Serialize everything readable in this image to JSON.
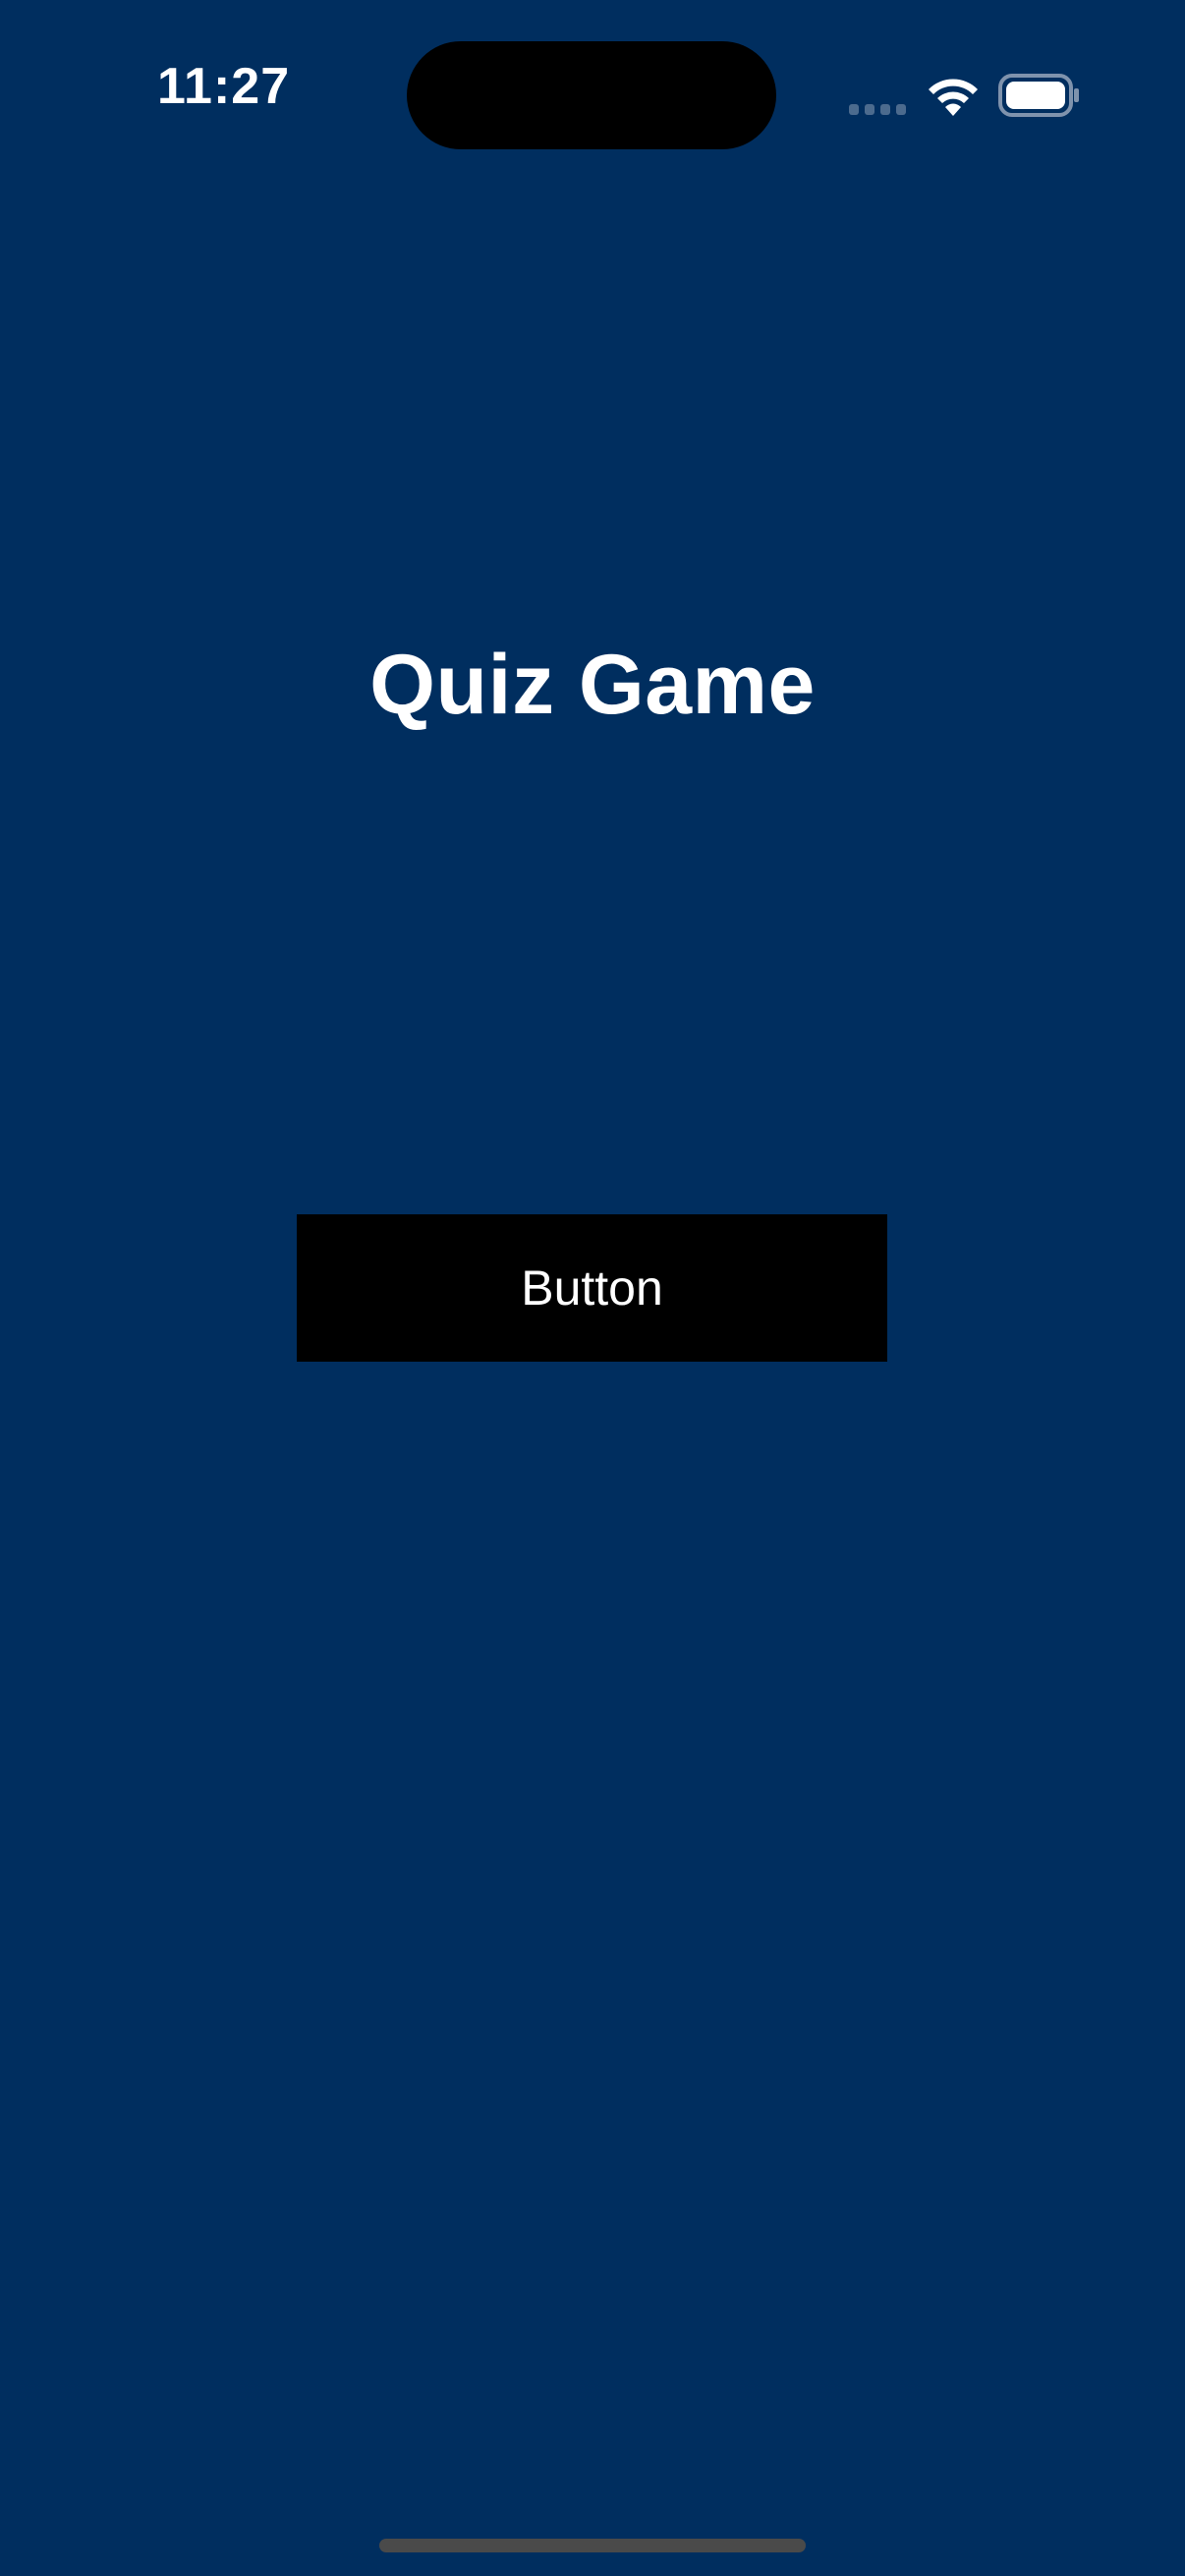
{
  "status_bar": {
    "time": "11:27",
    "icons": [
      "cellular-signal-icon",
      "wifi-icon",
      "battery-icon"
    ]
  },
  "main": {
    "title": "Quiz Game",
    "button_label": "Button"
  },
  "colors": {
    "background": "#002e5f",
    "button_background": "#000000",
    "text": "#ffffff"
  }
}
